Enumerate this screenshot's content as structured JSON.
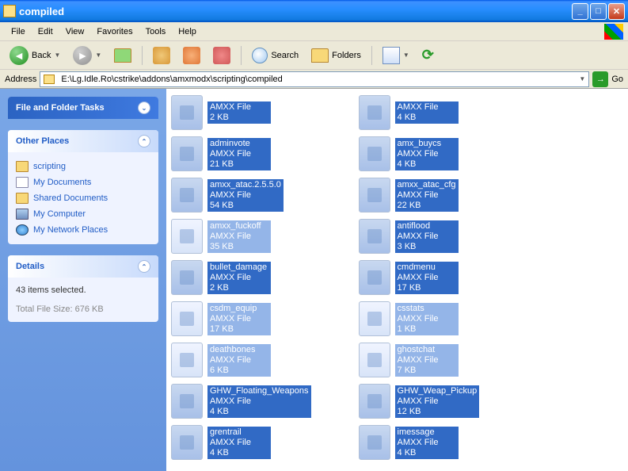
{
  "window": {
    "title": "compiled"
  },
  "menu": {
    "file": "File",
    "edit": "Edit",
    "view": "View",
    "favorites": "Favorites",
    "tools": "Tools",
    "help": "Help"
  },
  "toolbar": {
    "back": "Back",
    "search": "Search",
    "folders": "Folders"
  },
  "address": {
    "label": "Address",
    "path": "E:\\Lg.Idle.Ro\\cstrike\\addons\\amxmodx\\scripting\\compiled",
    "go": "Go"
  },
  "sidebar": {
    "tasks_title": "File and Folder Tasks",
    "places_title": "Other Places",
    "details_title": "Details",
    "places": [
      {
        "label": "scripting",
        "ico": "folder"
      },
      {
        "label": "My Documents",
        "ico": "doc"
      },
      {
        "label": "Shared Documents",
        "ico": "folder"
      },
      {
        "label": "My Computer",
        "ico": "comp"
      },
      {
        "label": "My Network Places",
        "ico": "net"
      }
    ],
    "details": {
      "line1": "43 items selected.",
      "line2": "Total File Size: 676 KB"
    }
  },
  "files": {
    "type_label": "AMXX File",
    "col1": [
      {
        "name": "",
        "size": "2 KB",
        "light": false
      },
      {
        "name": "adminvote",
        "size": "21 KB",
        "light": false
      },
      {
        "name": "amxx_atac.2.5.5.0",
        "size": "54 KB",
        "light": false
      },
      {
        "name": "amxx_fuckoff",
        "size": "35 KB",
        "light": true
      },
      {
        "name": "bullet_damage",
        "size": "2 KB",
        "light": false
      },
      {
        "name": "csdm_equip",
        "size": "17 KB",
        "light": true
      },
      {
        "name": "deathbones",
        "size": "6 KB",
        "light": true
      },
      {
        "name": "GHW_Floating_Weapons",
        "size": "4 KB",
        "light": false
      },
      {
        "name": "grentrail",
        "size": "4 KB",
        "light": false
      }
    ],
    "col2": [
      {
        "name": "",
        "size": "4 KB",
        "light": false
      },
      {
        "name": "amx_buycs",
        "size": "4 KB",
        "light": false
      },
      {
        "name": "amxx_atac_cfg",
        "size": "22 KB",
        "light": false
      },
      {
        "name": "antiflood",
        "size": "3 KB",
        "light": false
      },
      {
        "name": "cmdmenu",
        "size": "17 KB",
        "light": false
      },
      {
        "name": "csstats",
        "size": "1 KB",
        "light": true
      },
      {
        "name": "ghostchat",
        "size": "7 KB",
        "light": true
      },
      {
        "name": "GHW_Weap_Pickup",
        "size": "12 KB",
        "light": false
      },
      {
        "name": "imessage",
        "size": "4 KB",
        "light": false
      }
    ]
  }
}
